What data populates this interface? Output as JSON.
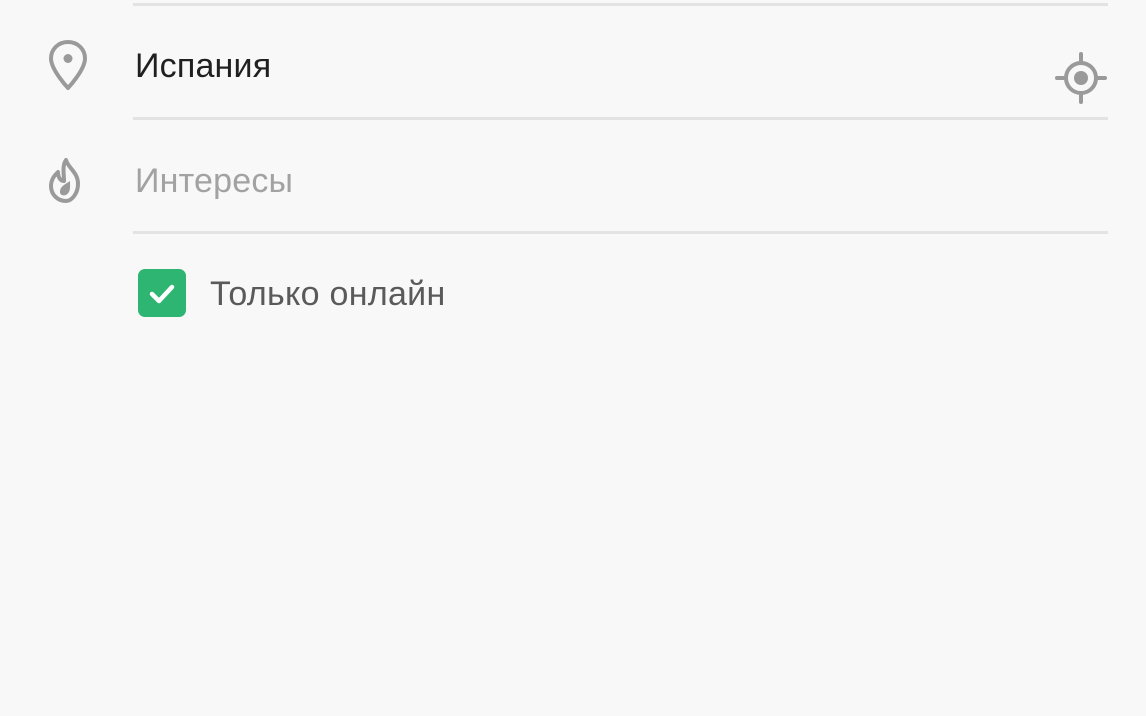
{
  "colors": {
    "background": "#f8f8f8",
    "divider": "#e3e3e3",
    "icon": "#9a9a9a",
    "accent_green": "#2db571",
    "text_primary": "#202020",
    "text_placeholder": "#a2a2a2",
    "text_label": "#5a5a5a"
  },
  "form": {
    "location": {
      "icon": "location-pin-icon",
      "value": "Испания",
      "action_icon": "my-location-icon"
    },
    "interests": {
      "icon": "flame-icon",
      "placeholder": "Интересы"
    },
    "online_only": {
      "label": "Только онлайн",
      "checked": true,
      "icon": "checkmark-icon"
    }
  }
}
